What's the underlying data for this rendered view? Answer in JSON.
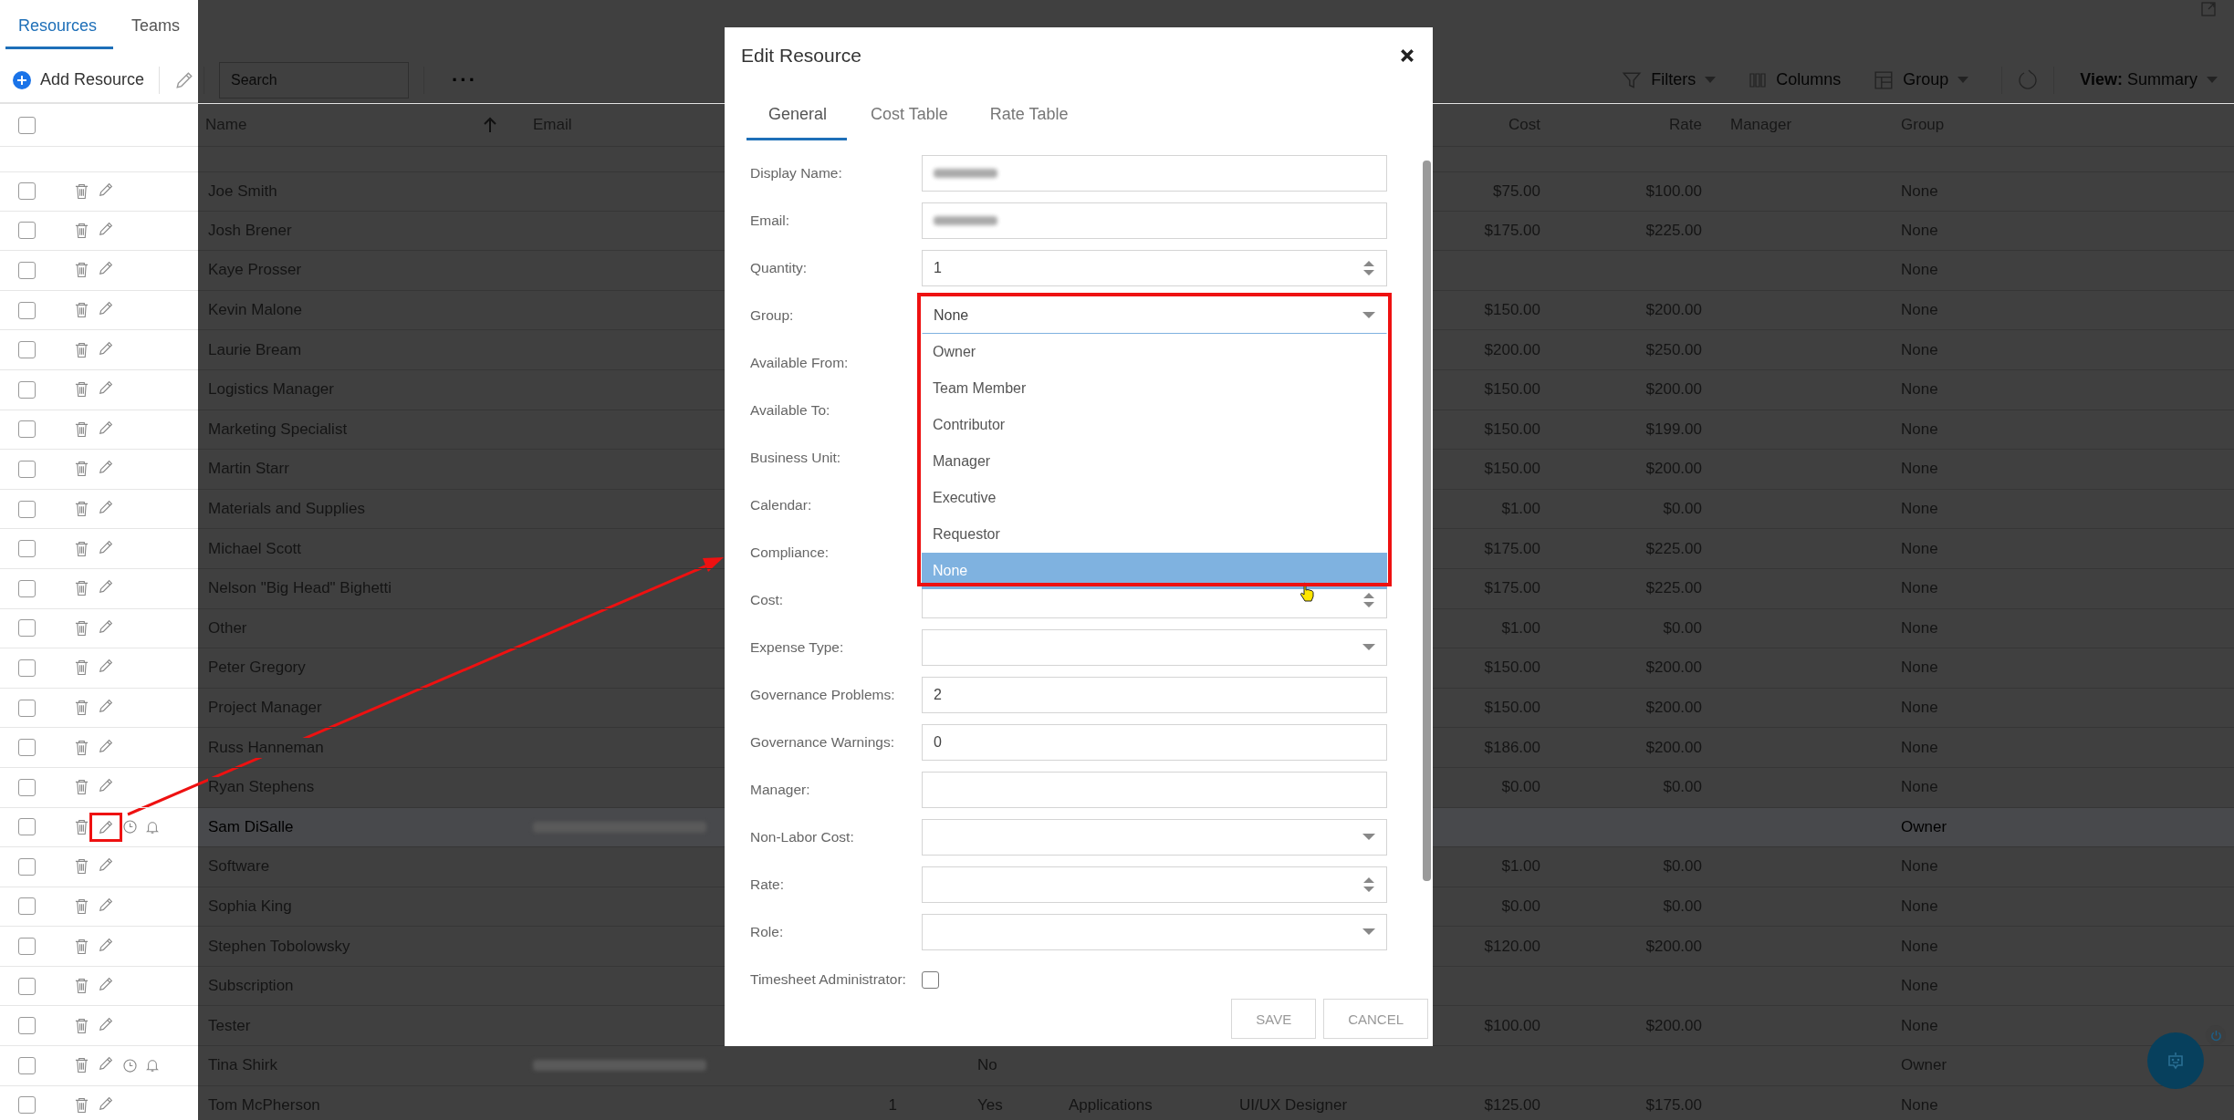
{
  "sidebar_tabs": [
    {
      "label": "Resources",
      "selected": true
    },
    {
      "label": "Teams",
      "selected": false
    }
  ],
  "toolbar": {
    "add_label": "Add Resource",
    "search": {
      "placeholder": "Search"
    },
    "more": "···",
    "filters": "Filters",
    "columns": "Columns",
    "group": "Group",
    "view_label": "View:",
    "view_value": "Summary"
  },
  "table": {
    "all_checked": false,
    "columns": [
      {
        "label": "Name",
        "sorted": true
      },
      {
        "label": "Email",
        "sorted": false
      },
      {
        "label": "Cost",
        "sorted": false
      },
      {
        "label": "Rate",
        "sorted": false
      },
      {
        "label": "Manager",
        "sorted": false
      },
      {
        "label": "Group",
        "sorted": false
      }
    ],
    "rows": [
      {
        "name": "Joe Smith",
        "cost": "$75.00",
        "rate": "$100.00",
        "group": "None",
        "checked": false,
        "selected": false,
        "email_blurred": false,
        "annotated": false,
        "actions": [
          {
            "kind": "delete"
          },
          {
            "kind": "edit"
          }
        ]
      },
      {
        "name": "Josh Brener",
        "cost": "$175.00",
        "rate": "$225.00",
        "group": "None",
        "checked": false,
        "selected": false,
        "email_blurred": false,
        "annotated": false,
        "actions": [
          {
            "kind": "delete"
          },
          {
            "kind": "edit"
          }
        ]
      },
      {
        "name": "Kaye Prosser",
        "group": "None",
        "checked": false,
        "selected": false,
        "email_blurred": false,
        "annotated": false,
        "actions": [
          {
            "kind": "delete"
          },
          {
            "kind": "edit"
          }
        ]
      },
      {
        "name": "Kevin Malone",
        "cost": "$150.00",
        "rate": "$200.00",
        "group": "None",
        "checked": false,
        "selected": false,
        "email_blurred": false,
        "annotated": false,
        "actions": [
          {
            "kind": "delete"
          },
          {
            "kind": "edit"
          }
        ]
      },
      {
        "name": "Laurie Bream",
        "cost": "$200.00",
        "rate": "$250.00",
        "group": "None",
        "checked": false,
        "selected": false,
        "email_blurred": false,
        "annotated": false,
        "actions": [
          {
            "kind": "delete"
          },
          {
            "kind": "edit"
          }
        ]
      },
      {
        "name": "Logistics Manager",
        "cost": "$150.00",
        "rate": "$200.00",
        "group": "None",
        "checked": false,
        "selected": false,
        "email_blurred": false,
        "annotated": false,
        "actions": [
          {
            "kind": "delete"
          },
          {
            "kind": "edit"
          }
        ]
      },
      {
        "name": "Marketing Specialist",
        "cost": "$150.00",
        "rate": "$199.00",
        "group": "None",
        "checked": false,
        "selected": false,
        "email_blurred": false,
        "annotated": false,
        "actions": [
          {
            "kind": "delete"
          },
          {
            "kind": "edit"
          }
        ]
      },
      {
        "name": "Martin Starr",
        "cost": "$150.00",
        "rate": "$200.00",
        "group": "None",
        "checked": false,
        "selected": false,
        "email_blurred": false,
        "annotated": false,
        "actions": [
          {
            "kind": "delete"
          },
          {
            "kind": "edit"
          }
        ]
      },
      {
        "name": "Materials and Supplies",
        "cost": "$1.00",
        "rate": "$0.00",
        "group": "None",
        "checked": false,
        "selected": false,
        "email_blurred": false,
        "annotated": false,
        "actions": [
          {
            "kind": "delete"
          },
          {
            "kind": "edit"
          }
        ]
      },
      {
        "name": "Michael Scott",
        "cost": "$175.00",
        "rate": "$225.00",
        "group": "None",
        "checked": false,
        "selected": false,
        "email_blurred": false,
        "annotated": false,
        "actions": [
          {
            "kind": "delete"
          },
          {
            "kind": "edit"
          }
        ]
      },
      {
        "name": "Nelson \"Big Head\" Bighetti",
        "cost": "$175.00",
        "rate": "$225.00",
        "group": "None",
        "checked": false,
        "selected": false,
        "email_blurred": false,
        "annotated": false,
        "actions": [
          {
            "kind": "delete"
          },
          {
            "kind": "edit"
          }
        ]
      },
      {
        "name": "Other",
        "cost": "$1.00",
        "rate": "$0.00",
        "group": "None",
        "checked": false,
        "selected": false,
        "email_blurred": false,
        "annotated": false,
        "actions": [
          {
            "kind": "delete"
          },
          {
            "kind": "edit"
          }
        ]
      },
      {
        "name": "Peter Gregory",
        "cost": "$150.00",
        "rate": "$200.00",
        "group": "None",
        "checked": false,
        "selected": false,
        "email_blurred": false,
        "annotated": false,
        "actions": [
          {
            "kind": "delete"
          },
          {
            "kind": "edit"
          }
        ]
      },
      {
        "name": "Project Manager",
        "cost": "$150.00",
        "rate": "$200.00",
        "group": "None",
        "checked": false,
        "selected": false,
        "email_blurred": false,
        "annotated": false,
        "actions": [
          {
            "kind": "delete"
          },
          {
            "kind": "edit"
          }
        ]
      },
      {
        "name": "Russ Hanneman",
        "cost": "$186.00",
        "rate": "$200.00",
        "group": "None",
        "checked": false,
        "selected": false,
        "email_blurred": false,
        "annotated": false,
        "actions": [
          {
            "kind": "delete"
          },
          {
            "kind": "edit"
          }
        ]
      },
      {
        "name": "Ryan Stephens",
        "cost": "$0.00",
        "rate": "$0.00",
        "group": "None",
        "checked": false,
        "selected": false,
        "email_blurred": false,
        "annotated": false,
        "actions": [
          {
            "kind": "delete"
          },
          {
            "kind": "edit"
          }
        ]
      },
      {
        "name": "Sam DiSalle",
        "group": "Owner",
        "checked": false,
        "selected": true,
        "email_blurred": true,
        "annotated": true,
        "actions": [
          {
            "kind": "delete"
          },
          {
            "kind": "edit"
          },
          {
            "kind": "history"
          },
          {
            "kind": "alert"
          }
        ]
      },
      {
        "name": "Software",
        "cost": "$1.00",
        "rate": "$0.00",
        "group": "None",
        "checked": false,
        "selected": false,
        "email_blurred": false,
        "annotated": false,
        "actions": [
          {
            "kind": "delete"
          },
          {
            "kind": "edit"
          }
        ]
      },
      {
        "name": "Sophia King",
        "cost": "$0.00",
        "rate": "$0.00",
        "group": "None",
        "checked": false,
        "selected": false,
        "email_blurred": false,
        "annotated": false,
        "actions": [
          {
            "kind": "delete"
          },
          {
            "kind": "edit"
          }
        ]
      },
      {
        "name": "Stephen Tobolowsky",
        "cost": "$120.00",
        "rate": "$200.00",
        "group": "None",
        "checked": false,
        "selected": false,
        "email_blurred": false,
        "annotated": false,
        "actions": [
          {
            "kind": "delete"
          },
          {
            "kind": "edit"
          }
        ]
      },
      {
        "name": "Subscription",
        "group": "None",
        "checked": false,
        "selected": false,
        "email_blurred": false,
        "annotated": false,
        "actions": [
          {
            "kind": "delete"
          },
          {
            "kind": "edit"
          }
        ]
      },
      {
        "name": "Tester",
        "cost": "$100.00",
        "rate": "$200.00",
        "group": "None",
        "checked": false,
        "selected": false,
        "email_blurred": false,
        "annotated": false,
        "actions": [
          {
            "kind": "delete"
          },
          {
            "kind": "edit"
          }
        ]
      },
      {
        "name": "Tina Shirk",
        "column_4": "No",
        "group": "Owner",
        "checked": false,
        "selected": false,
        "email_blurred": true,
        "annotated": false,
        "actions": [
          {
            "kind": "delete"
          },
          {
            "kind": "edit"
          },
          {
            "kind": "history"
          },
          {
            "kind": "alert"
          }
        ]
      },
      {
        "name": "Tom McPherson",
        "quantity": "1",
        "column_4": "Yes",
        "column_5": "Applications",
        "column_6": "UI/UX Designer",
        "cost": "$125.00",
        "rate": "$175.00",
        "group": "None",
        "checked": false,
        "selected": false,
        "email_blurred": false,
        "annotated": false,
        "actions": [
          {
            "kind": "delete"
          },
          {
            "kind": "edit"
          }
        ]
      }
    ]
  },
  "dialog": {
    "title": "Edit Resource",
    "tabs": [
      {
        "label": "General",
        "selected": true
      },
      {
        "label": "Cost Table",
        "selected": false
      },
      {
        "label": "Rate Table",
        "selected": false
      }
    ],
    "fields": [
      {
        "label": "Display Name:",
        "kind": "text",
        "blurred": true
      },
      {
        "label": "Email:",
        "kind": "text",
        "blurred": true
      },
      {
        "label": "Quantity:",
        "kind": "number",
        "value": "1"
      },
      {
        "label": "Group:",
        "kind": "select",
        "value": "None",
        "open": true,
        "annotated": true,
        "options": [
          {
            "label": "Owner",
            "selected": false
          },
          {
            "label": "Team Member",
            "selected": false
          },
          {
            "label": "Contributor",
            "selected": false
          },
          {
            "label": "Manager",
            "selected": false
          },
          {
            "label": "Executive",
            "selected": false
          },
          {
            "label": "Requestor",
            "selected": false
          },
          {
            "label": "None",
            "selected": true
          }
        ]
      },
      {
        "label": "Available From:",
        "kind": "covered"
      },
      {
        "label": "Available To:",
        "kind": "covered"
      },
      {
        "label": "Business Unit:",
        "kind": "covered"
      },
      {
        "label": "Calendar:",
        "kind": "covered"
      },
      {
        "label": "Compliance:",
        "kind": "covered"
      },
      {
        "label": "Cost:",
        "kind": "number"
      },
      {
        "label": "Expense Type:",
        "kind": "select"
      },
      {
        "label": "Governance Problems:",
        "kind": "text",
        "value": "2"
      },
      {
        "label": "Governance Warnings:",
        "kind": "text",
        "value": "0"
      },
      {
        "label": "Manager:",
        "kind": "text"
      },
      {
        "label": "Non-Labor Cost:",
        "kind": "select"
      },
      {
        "label": "Rate:",
        "kind": "number"
      },
      {
        "label": "Role:",
        "kind": "select"
      },
      {
        "label": "Timesheet Administrator:",
        "kind": "checkbox",
        "checked": false
      }
    ],
    "buttons": [
      {
        "label": "SAVE",
        "disabled": true
      },
      {
        "label": "CANCEL",
        "disabled": true
      }
    ]
  }
}
